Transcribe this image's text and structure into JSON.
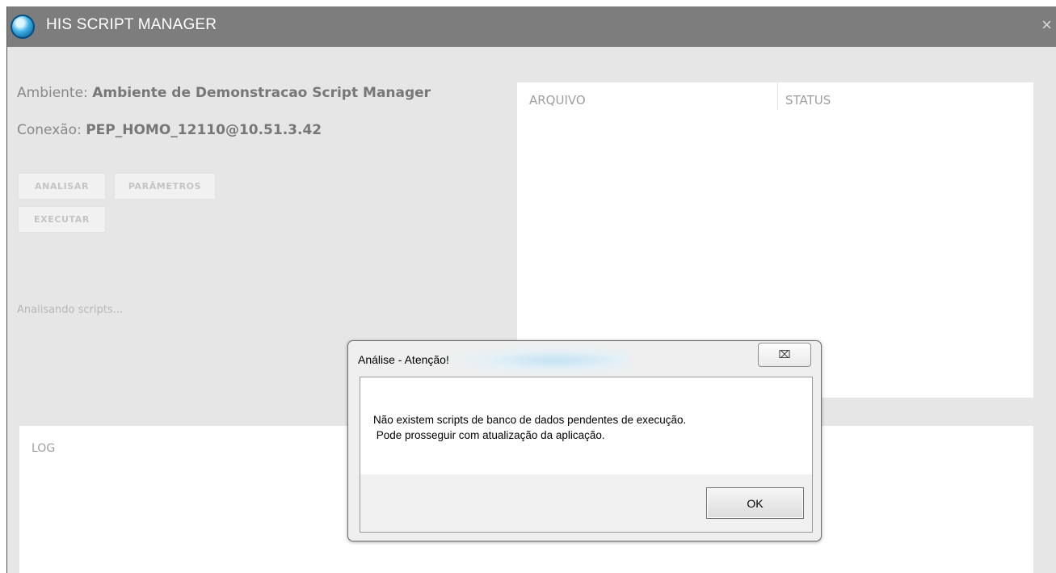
{
  "window": {
    "title": "HIS SCRIPT MANAGER",
    "close_glyph": "×",
    "icon": "app-logo-icon"
  },
  "info": {
    "ambiente_label": "Ambiente:",
    "ambiente_value": "Ambiente de Demonstracao Script Manager",
    "conexao_label": "Conexão:",
    "conexao_value": "PEP_HOMO_12110@10.51.3.42"
  },
  "buttons": {
    "analisar": "ANALISAR",
    "parametros": "PARÂMETROS",
    "executar": "EXECUTAR"
  },
  "status_text": "Analisando scripts...",
  "files_table": {
    "columns": [
      "ARQUIVO",
      "STATUS"
    ]
  },
  "log": {
    "header": "LOG"
  },
  "dialog": {
    "title": "Análise - Atenção!",
    "close_glyph": "⌧",
    "message_line1": "Não existem scripts de banco de dados pendentes de execução.",
    "message_line2": " Pode prosseguir com atualização da aplicação.",
    "ok_label": "OK"
  }
}
